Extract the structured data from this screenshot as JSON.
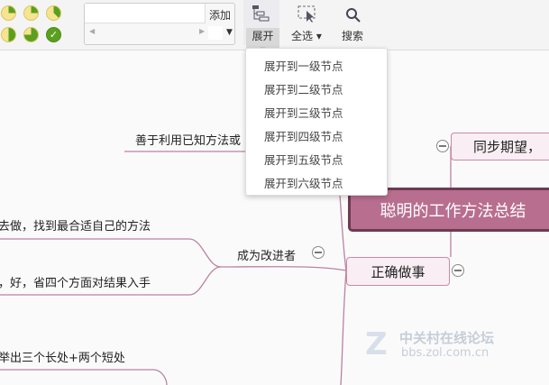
{
  "toolbar": {
    "add_label": "添加",
    "expand_label": "展开",
    "select_all_label": "全选",
    "search_label": "搜索",
    "input_value": ""
  },
  "expand_menu": {
    "items": [
      "展开到一级节点",
      "展开到二级节点",
      "展开到三级节点",
      "展开到四级节点",
      "展开到五级节点",
      "展开到六级节点"
    ]
  },
  "mindmap": {
    "central": "聪明的工作方法总结",
    "sync": "同步期望，",
    "correct": "正确做事",
    "improver": "成为改进者",
    "leverage": "善于利用已知方法或",
    "leaf1": "去做，找到最合适自己的方法",
    "leaf2": "，好，省四个方面对结果入手",
    "leaf3": "举出三个长处+两个短处"
  },
  "watermark": {
    "title": "中关村在线论坛",
    "url": "bbs.zol.com.cn"
  },
  "colors": {
    "central": "#b86e8f",
    "branch": "#c98aa6",
    "progress": "#5aa01e"
  }
}
